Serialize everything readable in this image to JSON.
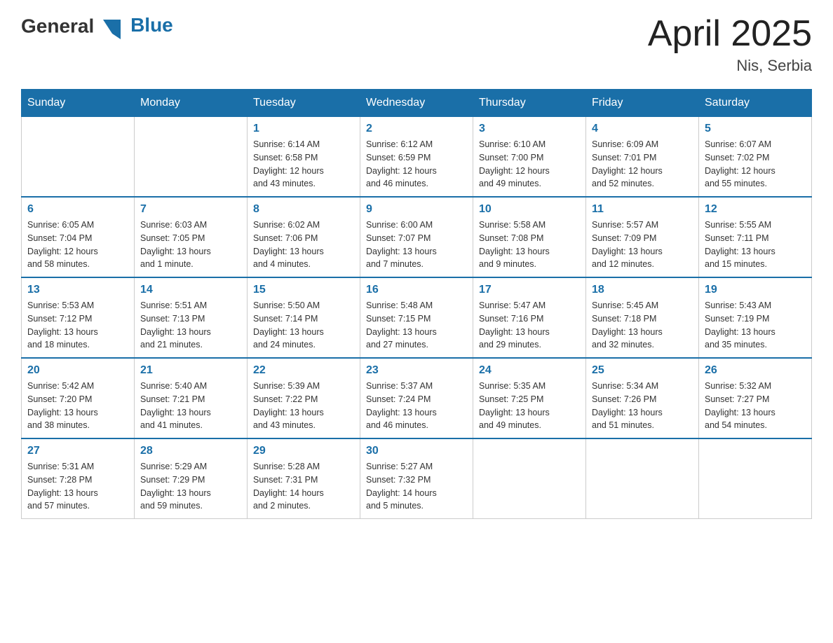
{
  "header": {
    "logo_text_black": "General",
    "logo_text_blue": "Blue",
    "month_year": "April 2025",
    "location": "Nis, Serbia"
  },
  "weekdays": [
    "Sunday",
    "Monday",
    "Tuesday",
    "Wednesday",
    "Thursday",
    "Friday",
    "Saturday"
  ],
  "weeks": [
    [
      {
        "day": "",
        "info": ""
      },
      {
        "day": "",
        "info": ""
      },
      {
        "day": "1",
        "info": "Sunrise: 6:14 AM\nSunset: 6:58 PM\nDaylight: 12 hours\nand 43 minutes."
      },
      {
        "day": "2",
        "info": "Sunrise: 6:12 AM\nSunset: 6:59 PM\nDaylight: 12 hours\nand 46 minutes."
      },
      {
        "day": "3",
        "info": "Sunrise: 6:10 AM\nSunset: 7:00 PM\nDaylight: 12 hours\nand 49 minutes."
      },
      {
        "day": "4",
        "info": "Sunrise: 6:09 AM\nSunset: 7:01 PM\nDaylight: 12 hours\nand 52 minutes."
      },
      {
        "day": "5",
        "info": "Sunrise: 6:07 AM\nSunset: 7:02 PM\nDaylight: 12 hours\nand 55 minutes."
      }
    ],
    [
      {
        "day": "6",
        "info": "Sunrise: 6:05 AM\nSunset: 7:04 PM\nDaylight: 12 hours\nand 58 minutes."
      },
      {
        "day": "7",
        "info": "Sunrise: 6:03 AM\nSunset: 7:05 PM\nDaylight: 13 hours\nand 1 minute."
      },
      {
        "day": "8",
        "info": "Sunrise: 6:02 AM\nSunset: 7:06 PM\nDaylight: 13 hours\nand 4 minutes."
      },
      {
        "day": "9",
        "info": "Sunrise: 6:00 AM\nSunset: 7:07 PM\nDaylight: 13 hours\nand 7 minutes."
      },
      {
        "day": "10",
        "info": "Sunrise: 5:58 AM\nSunset: 7:08 PM\nDaylight: 13 hours\nand 9 minutes."
      },
      {
        "day": "11",
        "info": "Sunrise: 5:57 AM\nSunset: 7:09 PM\nDaylight: 13 hours\nand 12 minutes."
      },
      {
        "day": "12",
        "info": "Sunrise: 5:55 AM\nSunset: 7:11 PM\nDaylight: 13 hours\nand 15 minutes."
      }
    ],
    [
      {
        "day": "13",
        "info": "Sunrise: 5:53 AM\nSunset: 7:12 PM\nDaylight: 13 hours\nand 18 minutes."
      },
      {
        "day": "14",
        "info": "Sunrise: 5:51 AM\nSunset: 7:13 PM\nDaylight: 13 hours\nand 21 minutes."
      },
      {
        "day": "15",
        "info": "Sunrise: 5:50 AM\nSunset: 7:14 PM\nDaylight: 13 hours\nand 24 minutes."
      },
      {
        "day": "16",
        "info": "Sunrise: 5:48 AM\nSunset: 7:15 PM\nDaylight: 13 hours\nand 27 minutes."
      },
      {
        "day": "17",
        "info": "Sunrise: 5:47 AM\nSunset: 7:16 PM\nDaylight: 13 hours\nand 29 minutes."
      },
      {
        "day": "18",
        "info": "Sunrise: 5:45 AM\nSunset: 7:18 PM\nDaylight: 13 hours\nand 32 minutes."
      },
      {
        "day": "19",
        "info": "Sunrise: 5:43 AM\nSunset: 7:19 PM\nDaylight: 13 hours\nand 35 minutes."
      }
    ],
    [
      {
        "day": "20",
        "info": "Sunrise: 5:42 AM\nSunset: 7:20 PM\nDaylight: 13 hours\nand 38 minutes."
      },
      {
        "day": "21",
        "info": "Sunrise: 5:40 AM\nSunset: 7:21 PM\nDaylight: 13 hours\nand 41 minutes."
      },
      {
        "day": "22",
        "info": "Sunrise: 5:39 AM\nSunset: 7:22 PM\nDaylight: 13 hours\nand 43 minutes."
      },
      {
        "day": "23",
        "info": "Sunrise: 5:37 AM\nSunset: 7:24 PM\nDaylight: 13 hours\nand 46 minutes."
      },
      {
        "day": "24",
        "info": "Sunrise: 5:35 AM\nSunset: 7:25 PM\nDaylight: 13 hours\nand 49 minutes."
      },
      {
        "day": "25",
        "info": "Sunrise: 5:34 AM\nSunset: 7:26 PM\nDaylight: 13 hours\nand 51 minutes."
      },
      {
        "day": "26",
        "info": "Sunrise: 5:32 AM\nSunset: 7:27 PM\nDaylight: 13 hours\nand 54 minutes."
      }
    ],
    [
      {
        "day": "27",
        "info": "Sunrise: 5:31 AM\nSunset: 7:28 PM\nDaylight: 13 hours\nand 57 minutes."
      },
      {
        "day": "28",
        "info": "Sunrise: 5:29 AM\nSunset: 7:29 PM\nDaylight: 13 hours\nand 59 minutes."
      },
      {
        "day": "29",
        "info": "Sunrise: 5:28 AM\nSunset: 7:31 PM\nDaylight: 14 hours\nand 2 minutes."
      },
      {
        "day": "30",
        "info": "Sunrise: 5:27 AM\nSunset: 7:32 PM\nDaylight: 14 hours\nand 5 minutes."
      },
      {
        "day": "",
        "info": ""
      },
      {
        "day": "",
        "info": ""
      },
      {
        "day": "",
        "info": ""
      }
    ]
  ]
}
